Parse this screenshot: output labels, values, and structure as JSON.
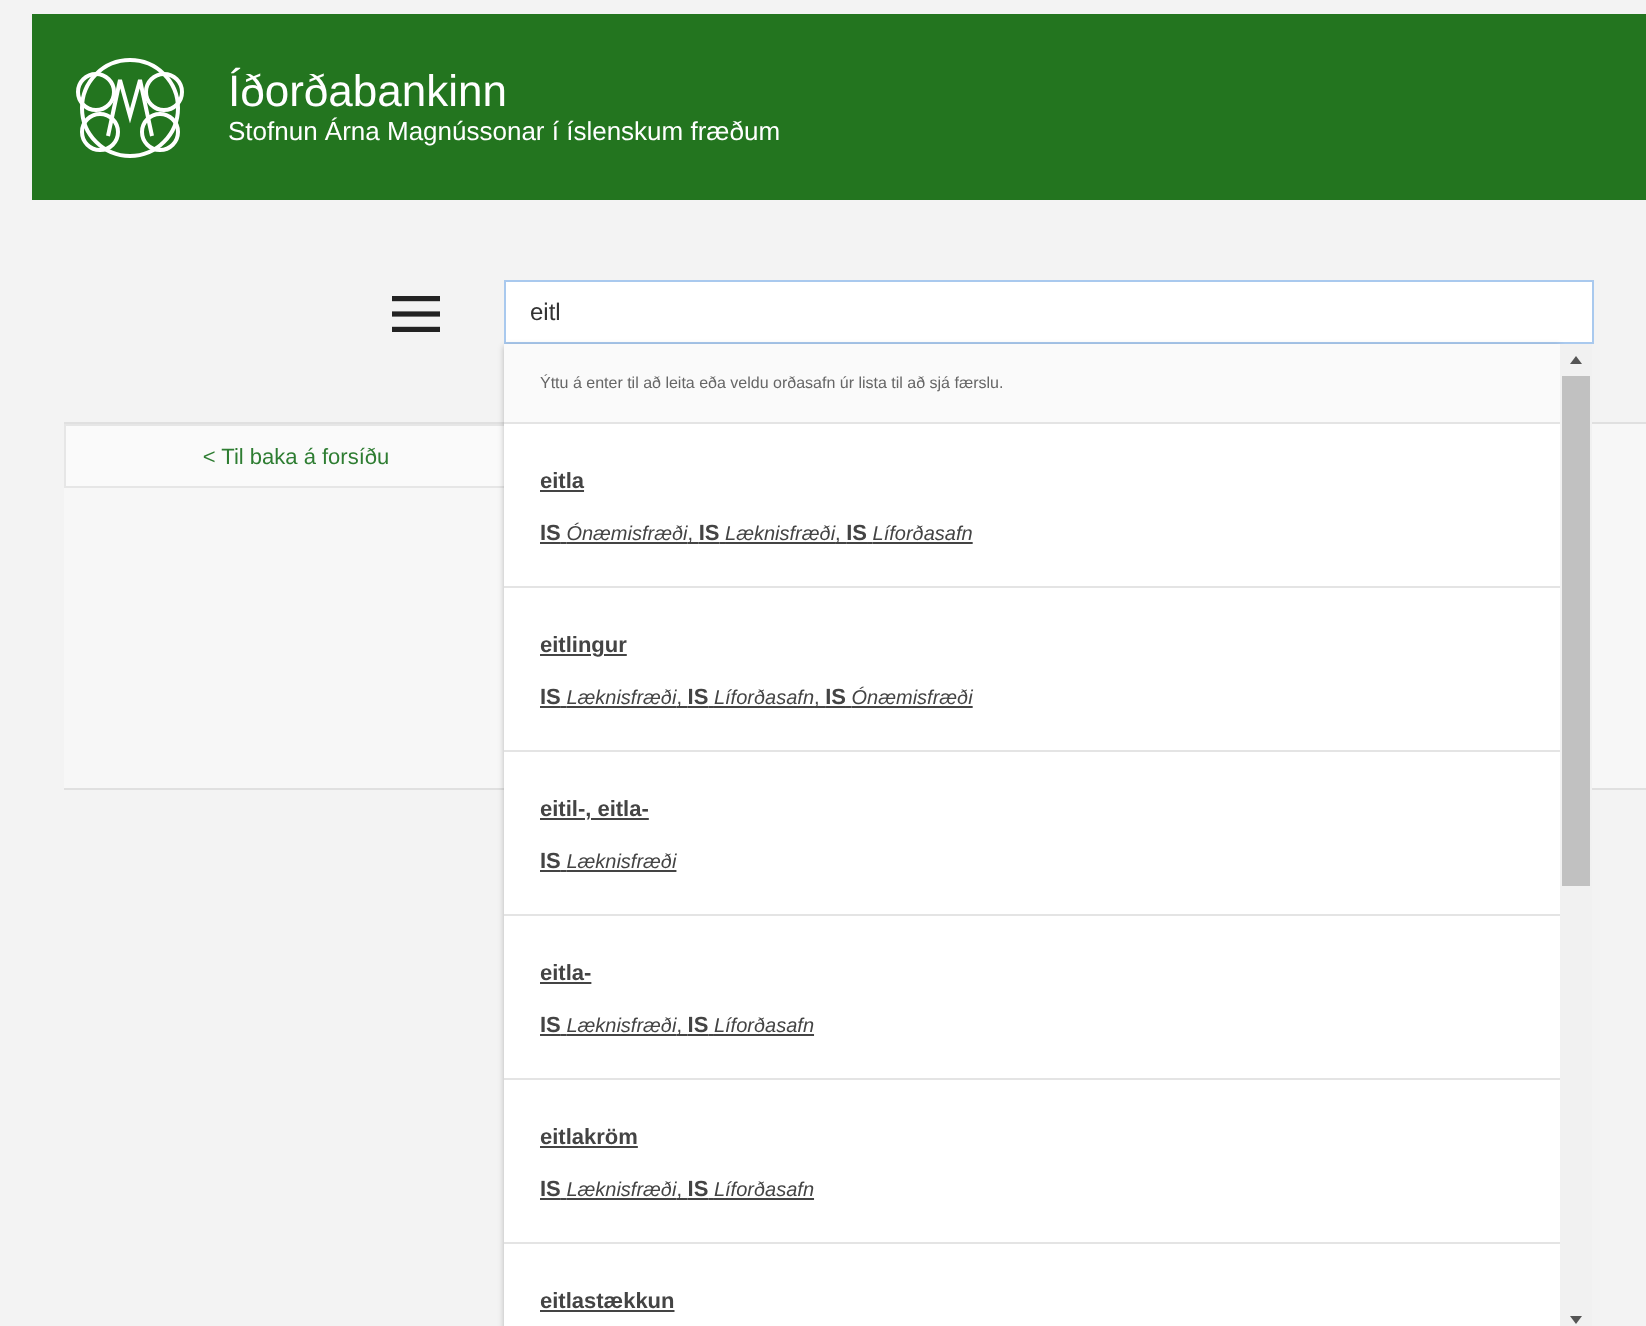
{
  "header": {
    "title": "Íðorðabankinn",
    "subtitle": "Stofnun Árna Magnússonar í íslenskum fræðum"
  },
  "search": {
    "value": "eitl",
    "hint": "Ýttu á enter til að leita eða veldu orðasafn úr lista til að sjá færslu.",
    "results": [
      {
        "term": "eitla",
        "sources": "**IS** *Ónæmisfræði*, **IS** *Læknisfræði*, **IS** *Líforðasafn*"
      },
      {
        "term": "eitlingur",
        "sources": "**IS** *Læknisfræði*, **IS** *Líforðasafn*, **IS** *Ónæmisfræði*"
      },
      {
        "term": "eitil-, eitla-",
        "sources": "**IS** *Læknisfræði*"
      },
      {
        "term": "eitla-",
        "sources": "**IS** *Læknisfræði*, **IS** *Líforðasafn*"
      },
      {
        "term": "eitlakröm",
        "sources": "**IS** *Læknisfræði*, **IS** *Líforðasafn*"
      },
      {
        "term": "eitlastækkun"
      }
    ]
  },
  "back_link": "< Til baka á forsíðu"
}
